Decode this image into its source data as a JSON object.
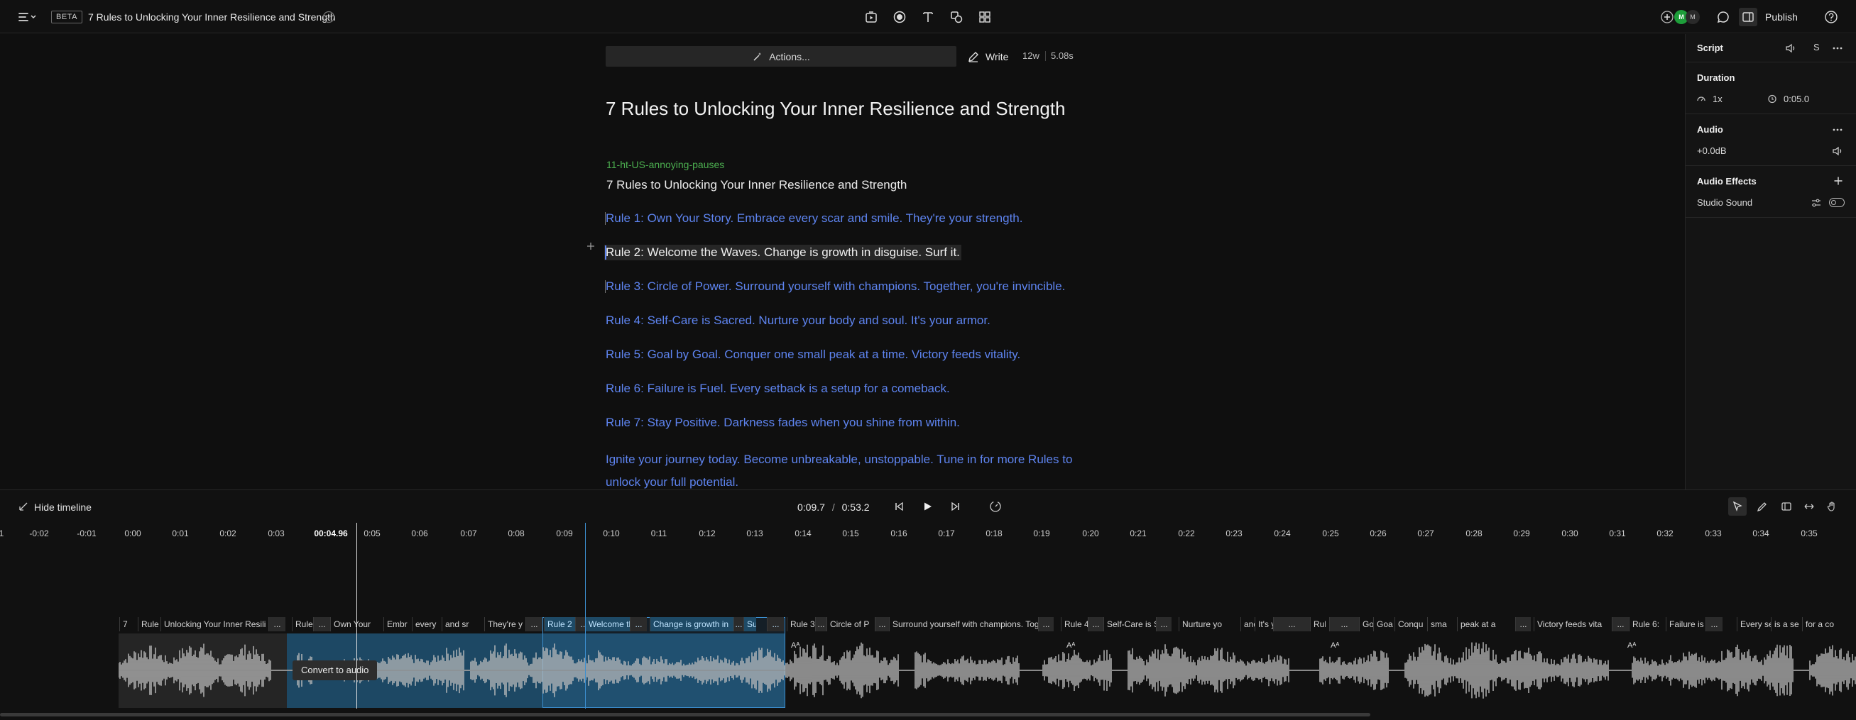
{
  "topbar": {
    "badge": "BETA",
    "doc_title": "7 Rules to Unlocking Your Inner Resilience and Strength",
    "publish_label": "Publish",
    "avatars": [
      {
        "initials": "M",
        "color": "#1e9e3a"
      },
      {
        "initials": "M",
        "color": "#2a2a2a"
      }
    ]
  },
  "editor": {
    "actions_label": "Actions...",
    "write_label": "Write",
    "word_count": "12w",
    "duration": "5.08s",
    "heading": "7 Rules to Unlocking Your Inner Resilience and Strength",
    "speaker": "11-ht-US-annoying-pauses",
    "title_line": "7 Rules to Unlocking Your Inner Resilience and Strength",
    "rules": [
      "Rule 1: Own Your Story. Embrace every scar and smile. They're your strength.",
      "Rule 2: Welcome the Waves. Change is growth in disguise. Surf it.",
      "Rule 3: Circle of Power. Surround yourself with champions. Together, you're invincible.",
      "Rule 4: Self-Care is Sacred. Nurture your body and soul. It's your armor.",
      "Rule 5: Goal by Goal. Conquer one small peak at a time. Victory feeds vitality.",
      "Rule 6: Failure is Fuel. Every setback is a setup for a comeback.",
      "Rule 7: Stay Positive. Darkness fades when you shine from within."
    ],
    "closing": "Ignite your journey today. Become unbreakable, unstoppable. Tune in for more Rules to unlock your full potential."
  },
  "panel": {
    "header": "Script",
    "script_speed_letter": "S",
    "duration_label": "Duration",
    "speed": "1x",
    "duration_value": "0:05.0",
    "audio_label": "Audio",
    "gain": "+0.0dB",
    "effects_label": "Audio Effects",
    "effect_name": "Studio Sound"
  },
  "timeline": {
    "hide_label": "Hide timeline",
    "current_time": "0:09.7",
    "separator": "/",
    "total_time": "0:53.2",
    "convert_label": "Convert to audio",
    "aa_marker": "Aᴬ",
    "ticks": [
      "1",
      "-0:02",
      "-0:01",
      "0:00",
      "0:01",
      "0:02",
      "0:03",
      "00:04.96",
      "0:05",
      "0:06",
      "0:07",
      "0:08",
      "0:09",
      "0:10",
      "0:11",
      "0:12",
      "0:13",
      "0:14",
      "0:15",
      "0:16",
      "0:17",
      "0:18",
      "0:19",
      "0:20",
      "0:21",
      "0:22",
      "0:23",
      "0:24",
      "0:25",
      "0:26",
      "0:27",
      "0:28",
      "0:29",
      "0:30",
      "0:31",
      "0:32",
      "0:33",
      "0:34",
      "0:35"
    ],
    "words": [
      "7",
      "Rule",
      "Unlocking Your Inner Resili",
      "...",
      "Rule 1",
      "...",
      "Own Your",
      "Embr",
      "every",
      "and sr",
      "They're y",
      "...",
      "Rule 2",
      "...",
      "Welcome th",
      "...",
      "Change is growth in",
      "...",
      "Su",
      "...",
      "Rule 3:",
      "...",
      "Circle of P",
      "...",
      "Surround yourself with champions. Tog",
      "...",
      "Rule 4",
      "...",
      "Self-Care is S",
      "...",
      "Nurture yo",
      "and s",
      "It's your",
      "...",
      "Rule 5",
      "...",
      "Goa",
      "Goa",
      "Conqu",
      "sma",
      "peak at a",
      "...",
      "Victory feeds vita",
      "...",
      "Rule 6:",
      "Failure is Fu",
      "...",
      "Every se",
      "is a se",
      "for a co"
    ]
  }
}
